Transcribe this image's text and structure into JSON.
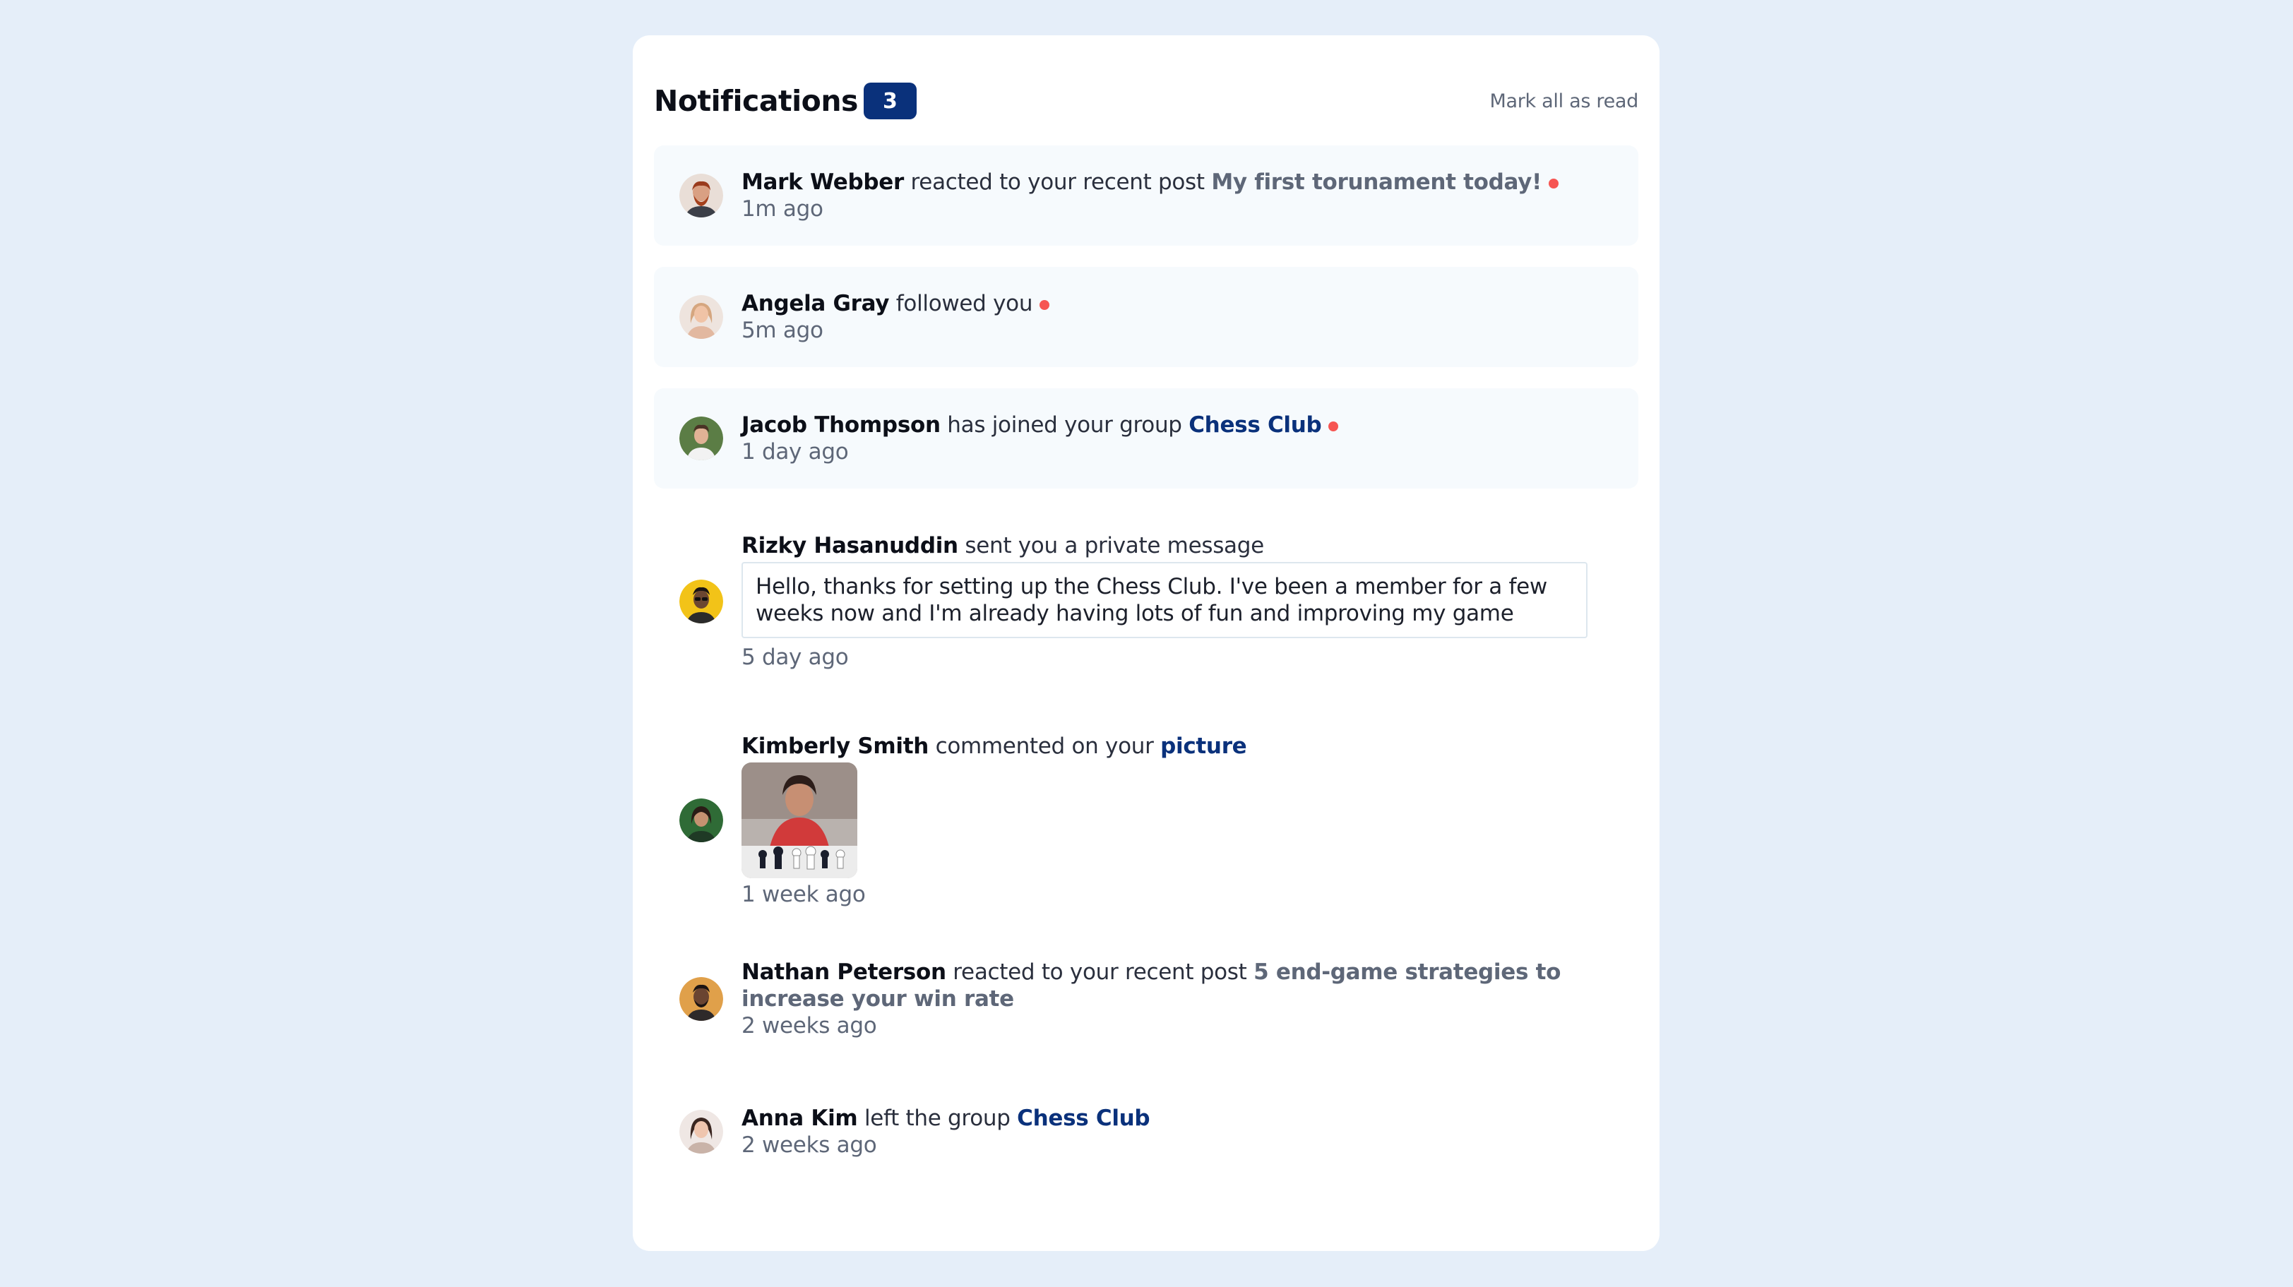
{
  "header": {
    "title": "Notifications",
    "unread_count": "3",
    "mark_all_label": "Mark all as read"
  },
  "notifications": [
    {
      "name": "Mark Webber",
      "action": " reacted to your recent post ",
      "target": "My first torunament today!",
      "time": "1m ago",
      "unread": true
    },
    {
      "name": "Angela Gray",
      "action": " followed you",
      "time": "5m ago",
      "unread": true
    },
    {
      "name": "Jacob Thompson",
      "action": " has joined your group ",
      "target": "Chess Club",
      "time": "1 day ago",
      "unread": true
    },
    {
      "name": "Rizky Hasanuddin",
      "action": " sent you a private message",
      "message": "Hello, thanks for setting up the Chess Club. I've been a member for a few weeks now and I'm already having lots of fun and improving my game",
      "time": "5 day ago",
      "unread": false
    },
    {
      "name": "Kimberly Smith",
      "action": " commented on your ",
      "target": "picture",
      "time": "1 week ago",
      "unread": false
    },
    {
      "name": "Nathan Peterson",
      "action": " reacted to your recent post ",
      "target": "5 end-game strategies to increase your win rate",
      "time": "2 weeks ago",
      "unread": false
    },
    {
      "name": "Anna Kim",
      "action": " left the group ",
      "target": "Chess Club",
      "time": "2 weeks ago",
      "unread": false
    }
  ],
  "colors": {
    "page_bg": "#e5eef9",
    "card_bg": "#ffffff",
    "unread_bg": "#f6fafd",
    "accent_blue": "#0a317b",
    "unread_dot": "#f65552",
    "muted_text": "#5e6778"
  }
}
